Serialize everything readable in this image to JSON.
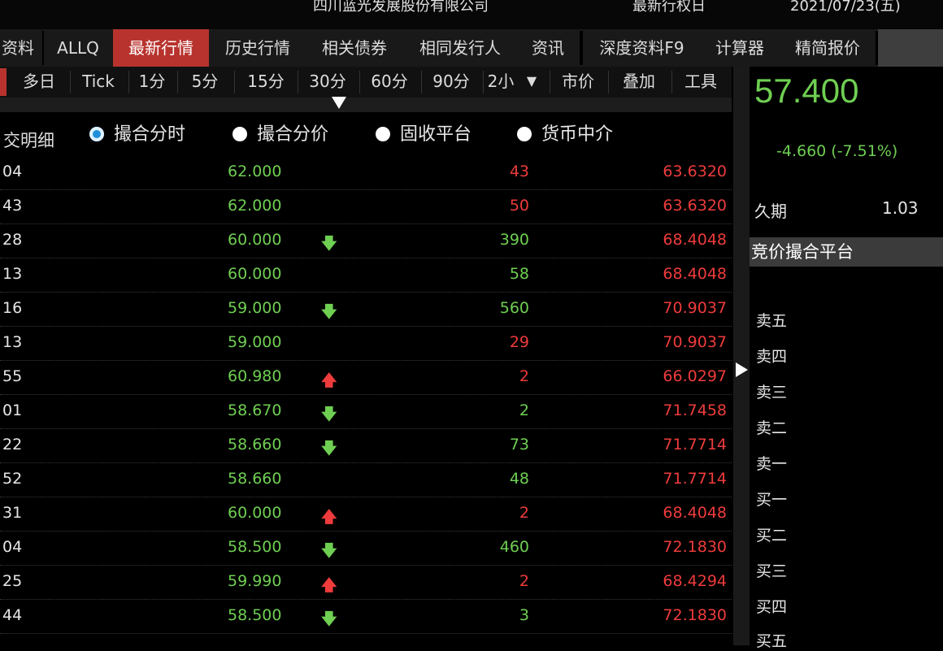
{
  "header": {
    "issuer": "四川蓝光发展股份有限公司",
    "label_date": "最新行权日",
    "date": "2021/07/23(五)"
  },
  "tabs": [
    {
      "label": "资料"
    },
    {
      "label": "ALLQ"
    },
    {
      "label": "最新行情",
      "active": true
    },
    {
      "label": "历史行情"
    },
    {
      "label": "相关债券"
    },
    {
      "label": "相同发行人"
    },
    {
      "label": "资讯"
    },
    {
      "label": "深度资料F9"
    },
    {
      "label": "计算器"
    },
    {
      "label": "精简报价"
    }
  ],
  "periods": [
    "多日",
    "Tick",
    "1分",
    "5分",
    "15分",
    "30分",
    "60分",
    "90分",
    "2小",
    "市价",
    "叠加",
    "工具"
  ],
  "detail_label": "交明细",
  "radios": [
    {
      "label": "撮合分时",
      "checked": true
    },
    {
      "label": "撮合分价",
      "checked": false
    },
    {
      "label": "固收平台",
      "checked": false
    },
    {
      "label": "货币中介",
      "checked": false
    }
  ],
  "trades": [
    {
      "time": "04",
      "price": "62.000",
      "dir": "",
      "vol": "43",
      "vol_color": "up",
      "yield": "63.6320"
    },
    {
      "time": "43",
      "price": "62.000",
      "dir": "",
      "vol": "50",
      "vol_color": "up",
      "yield": "63.6320"
    },
    {
      "time": "28",
      "price": "60.000",
      "dir": "down",
      "vol": "390",
      "vol_color": "down",
      "yield": "68.4048"
    },
    {
      "time": "13",
      "price": "60.000",
      "dir": "",
      "vol": "58",
      "vol_color": "down",
      "yield": "68.4048"
    },
    {
      "time": "16",
      "price": "59.000",
      "dir": "down",
      "vol": "560",
      "vol_color": "down",
      "yield": "70.9037"
    },
    {
      "time": "13",
      "price": "59.000",
      "dir": "",
      "vol": "29",
      "vol_color": "up",
      "yield": "70.9037"
    },
    {
      "time": "55",
      "price": "60.980",
      "dir": "up",
      "vol": "2",
      "vol_color": "up",
      "yield": "66.0297"
    },
    {
      "time": "01",
      "price": "58.670",
      "dir": "down",
      "vol": "2",
      "vol_color": "down",
      "yield": "71.7458"
    },
    {
      "time": "22",
      "price": "58.660",
      "dir": "down",
      "vol": "73",
      "vol_color": "down",
      "yield": "71.7714"
    },
    {
      "time": "52",
      "price": "58.660",
      "dir": "",
      "vol": "48",
      "vol_color": "down",
      "yield": "71.7714"
    },
    {
      "time": "31",
      "price": "60.000",
      "dir": "up",
      "vol": "2",
      "vol_color": "up",
      "yield": "68.4048"
    },
    {
      "time": "04",
      "price": "58.500",
      "dir": "down",
      "vol": "460",
      "vol_color": "down",
      "yield": "72.1830"
    },
    {
      "time": "25",
      "price": "59.990",
      "dir": "up",
      "vol": "2",
      "vol_color": "up",
      "yield": "68.4294"
    },
    {
      "time": "44",
      "price": "58.500",
      "dir": "down",
      "vol": "3",
      "vol_color": "down",
      "yield": "72.1830"
    }
  ],
  "arrows": {
    "up": "🡅",
    "down": "🡇"
  },
  "quote": {
    "last": "57.400",
    "change": "-4.660 (-7.51%)",
    "duration_label": "久期",
    "duration_value": "1.03",
    "platform": "竞价撮合平台",
    "book": [
      "卖五",
      "卖四",
      "卖三",
      "卖二",
      "卖一",
      "买一",
      "买二",
      "买三",
      "买四",
      "买五"
    ]
  },
  "colors": {
    "up": "#ee3b3b",
    "down": "#6fcf52",
    "active_tab": "#b8332e",
    "radio_checked": "#1f8fd9"
  }
}
